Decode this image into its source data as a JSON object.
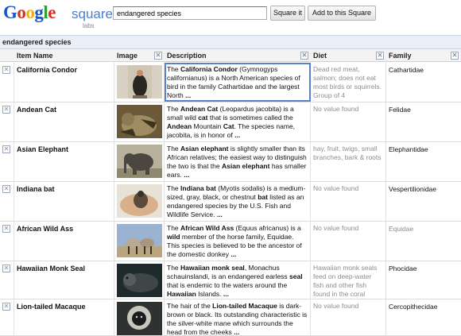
{
  "logo": {
    "letters": [
      "G",
      "o",
      "o",
      "g",
      "l",
      "e"
    ],
    "squared": "squared",
    "labs": "labs"
  },
  "search": {
    "value": "endangered species"
  },
  "buttons": {
    "square_it": "Square it",
    "add": "Add to this Square"
  },
  "square_title": "endangered species",
  "columns": {
    "name": "Item Name",
    "image": "Image",
    "description": "Description",
    "diet": "Diet",
    "family": "Family"
  },
  "close_glyph": "✕",
  "rows": [
    {
      "name": "California Condor",
      "desc": [
        "The ",
        "California Condor",
        " (Gymnogyps californianus) is a North American species of bird in the family Cathartidae and the largest North ",
        "..."
      ],
      "diet": "Dead red meat, salmon; does not eat most birds or squirrels. Group of 4",
      "family": "Cathartidae"
    },
    {
      "name": "Andean Cat",
      "desc": [
        "The ",
        "Andean Cat",
        " (Leopardus jacobita) is a small wild ",
        "cat",
        " that is sometimes called the ",
        "Andean",
        " Mountain ",
        "Cat",
        ". The species name, jacobita, is in honor of ",
        "..."
      ],
      "diet": "No value found",
      "family": "Felidae"
    },
    {
      "name": "Asian Elephant",
      "desc": [
        "The ",
        "Asian elephant",
        " is slightly smaller than its African relatives; the easiest way to distinguish the two is that the ",
        "Asian elephant",
        " has smaller ears. ",
        "..."
      ],
      "diet": "hay, fruit, twigs, small branches, bark & roots",
      "family": "Elephantidae"
    },
    {
      "name": "Indiana bat",
      "desc": [
        "The ",
        "Indiana bat",
        " (Myotis sodalis) is a medium-sized, gray, black, or chestnut ",
        "bat",
        " listed as an endangered species by the U.S. Fish and Wildlife Service. ",
        "..."
      ],
      "diet": "No value found",
      "family": "Vespertilionidae"
    },
    {
      "name": "African Wild Ass",
      "desc": [
        "The ",
        "African Wild Ass",
        " (Equus africanus) is a ",
        "wild",
        " member of the horse family, Equidae. This species is believed to be the ancestor of the domestic donkey ",
        "..."
      ],
      "diet": "No value found",
      "family": "Equidae"
    },
    {
      "name": "Hawaiian Monk Seal",
      "desc": [
        "The ",
        "Hawaiian monk seal",
        ", Monachus schauinslandi, is an endangered earless ",
        "seal",
        " that is endemic to the waters around the ",
        "Hawaiian",
        " Islands. ",
        "..."
      ],
      "diet": "Hawaiian monk seals feed on deep-water fish and other fish found in the coral",
      "family": "Phocidae"
    },
    {
      "name": "Lion-tailed Macaque",
      "desc": [
        "The hair of the ",
        "Lion-tailed Macaque",
        " is dark-brown or black. Its outstanding characteristic is the silver-white mane which surrounds the head from the cheeks ",
        "..."
      ],
      "diet": "No value found",
      "family": "Cercopithecidae"
    }
  ]
}
